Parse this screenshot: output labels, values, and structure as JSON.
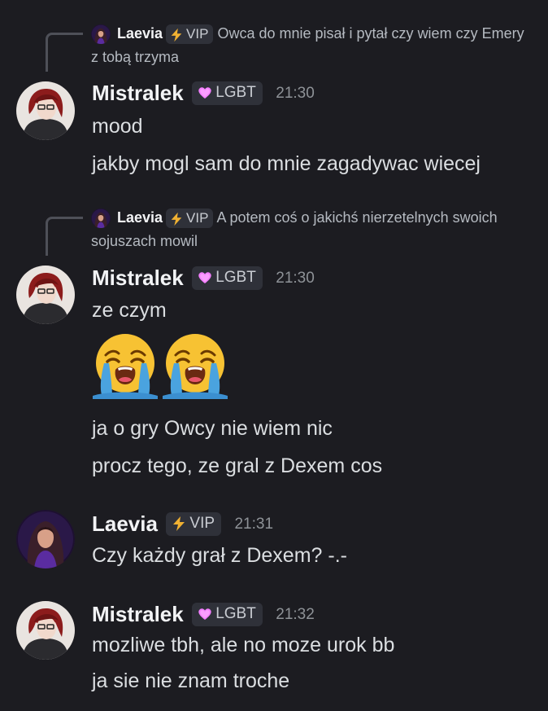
{
  "colors": {
    "background": "#1c1c21",
    "badge_bg": "#2f3139",
    "username": "#f2f3f5",
    "text": "#dbdee1",
    "timestamp": "#8e9297",
    "vip_icon": "#f0b132",
    "lgbt_icon": "#f47fff"
  },
  "messages": [
    {
      "reply": {
        "author": "Laevia",
        "badge": "VIP",
        "badge_icon": "lightning-icon",
        "text": "Owca do mnie pisał i pytał czy  wiem czy Emery z tobą trzyma"
      },
      "author": "Mistralek",
      "badge": "LGBT",
      "badge_icon": "heart-icon",
      "time": "21:30",
      "lines": [
        "mood",
        "jakby mogl sam do mnie zagadywac wiecej"
      ]
    },
    {
      "reply": {
        "author": "Laevia",
        "badge": "VIP",
        "badge_icon": "lightning-icon",
        "text": "A potem coś o jakichś nierzetelnych swoich sojuszach mowil"
      },
      "author": "Mistralek",
      "badge": "LGBT",
      "badge_icon": "heart-icon",
      "time": "21:30",
      "lines": [
        "ze czym",
        "ja o gry Owcy nie wiem nic",
        "procz tego, ze gral z Dexem cos"
      ],
      "emojis": [
        "loudly-crying-face",
        "loudly-crying-face"
      ]
    },
    {
      "author": "Laevia",
      "badge": "VIP",
      "badge_icon": "lightning-icon",
      "time": "21:31",
      "lines": [
        "Czy każdy grał z Dexem? -.-"
      ]
    },
    {
      "author": "Mistralek",
      "badge": "LGBT",
      "badge_icon": "heart-icon",
      "time": "21:32",
      "lines": [
        "mozliwe tbh, ale no moze urok bb",
        "ja sie nie znam troche"
      ]
    }
  ]
}
